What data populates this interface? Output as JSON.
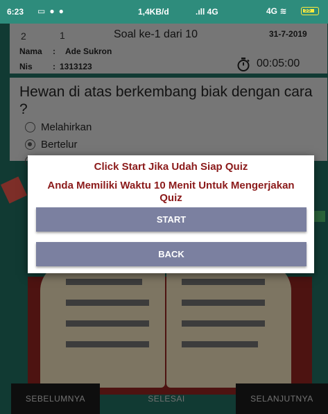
{
  "status_bar": {
    "time": "6:23",
    "network_speed": "1,4KB/d",
    "signal_1": "4G",
    "signal_2": "4G",
    "battery": "55"
  },
  "header": {
    "number_left": "2",
    "number_right": "1",
    "title": "Soal ke-1 dari 10",
    "date": "31-7-2019",
    "name_label": "Nama",
    "name_value": "Ade Sukron",
    "nis_label": "Nis",
    "nis_value": "1313123",
    "timer": "00:05:00",
    "separator": ":"
  },
  "question": {
    "text": "Hewan di atas berkembang biak dengan cara ?",
    "options": [
      {
        "label": "Melahirkan",
        "selected": false
      },
      {
        "label": "Bertelur",
        "selected": true
      },
      {
        "label": "",
        "selected": false
      }
    ]
  },
  "dialog": {
    "title": "Click Start Jika Udah Siap Quiz",
    "message": "Anda Memiliki Waktu 10 Menit Untuk Mengerjakan Quiz",
    "start_label": "START",
    "back_label": "BACK"
  },
  "bottom_nav": {
    "prev_label": "SEBELUMNYA",
    "finish_label": "SELESAI",
    "next_label": "SELANJUTNYA"
  },
  "colors": {
    "status_bar": "#2e8c7c",
    "background": "#1f6b5e",
    "dialog_text": "#8b1a1a",
    "dialog_button": "#7b80a0",
    "card": "#d7d7d7"
  },
  "icons": [
    "gallery-icon",
    "circle-icon",
    "hotspot-icon",
    "wifi-icon",
    "battery-icon",
    "stopwatch-icon"
  ]
}
